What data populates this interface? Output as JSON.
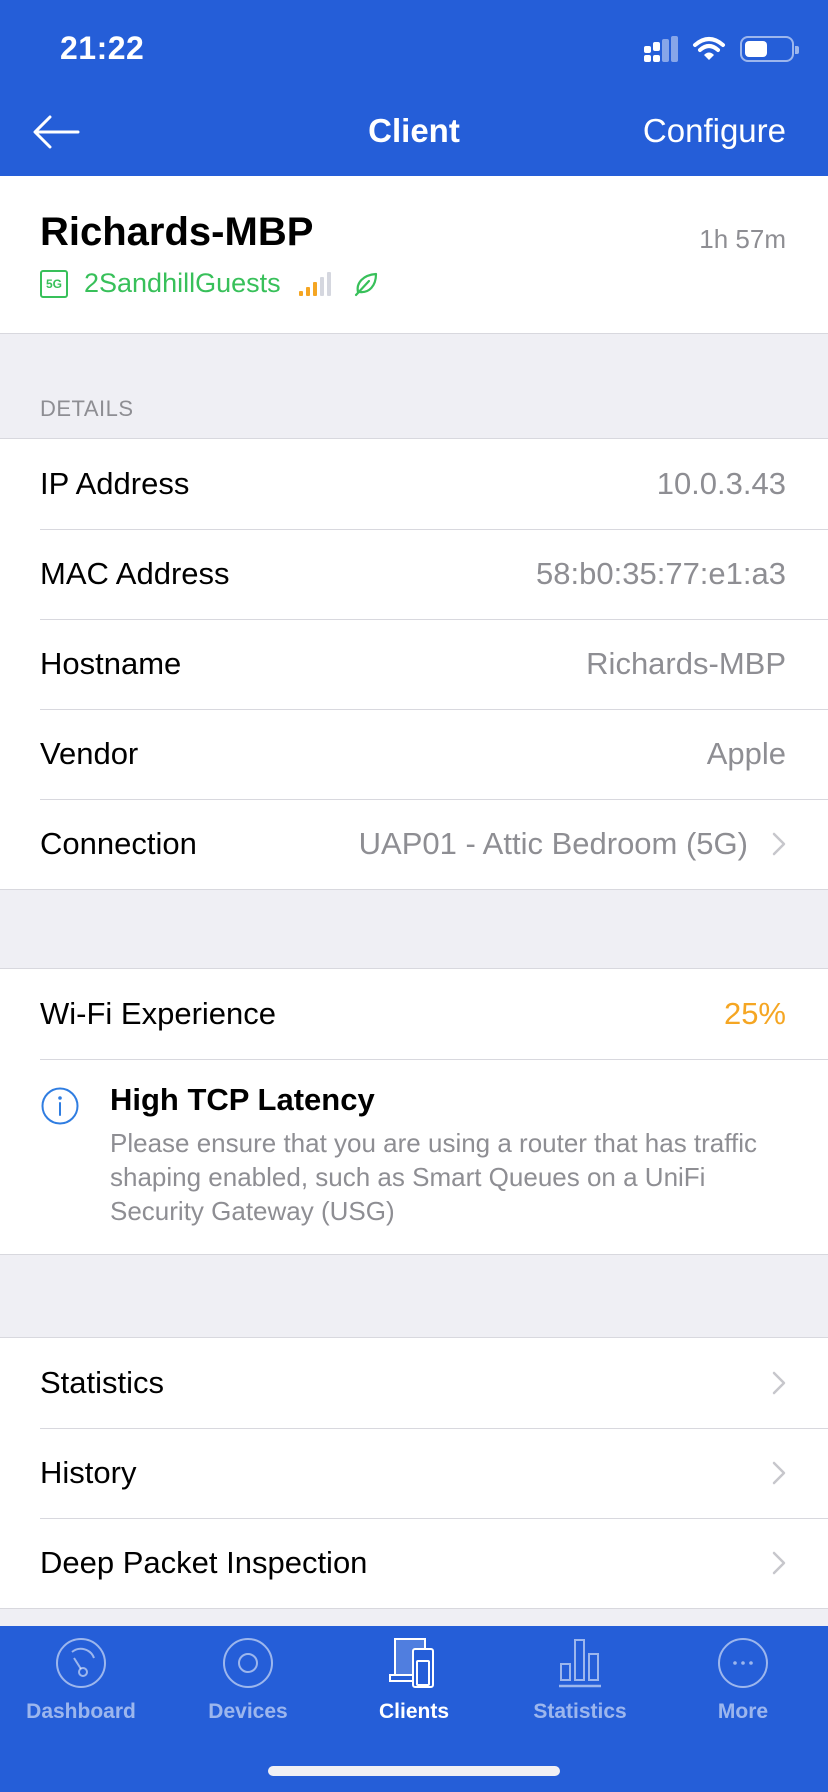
{
  "status_bar": {
    "time": "21:22"
  },
  "nav": {
    "title": "Client",
    "configure_label": "Configure",
    "back_icon": "arrow-left-icon"
  },
  "client": {
    "name": "Richards-MBP",
    "uptime": "1h 57m",
    "band": "5G",
    "ssid": "2SandhillGuests",
    "signal": {
      "active_bars": 3,
      "total_bars": 5,
      "active_color": "#f5a623",
      "inactive_color": "#d5d7df"
    },
    "power_save_icon": "leaf-icon"
  },
  "details": {
    "header": "DETAILS",
    "rows": [
      {
        "label": "IP Address",
        "value": "10.0.3.43"
      },
      {
        "label": "MAC Address",
        "value": "58:b0:35:77:e1:a3"
      },
      {
        "label": "Hostname",
        "value": "Richards-MBP"
      },
      {
        "label": "Vendor",
        "value": "Apple"
      },
      {
        "label": "Connection",
        "value": "UAP01 - Attic Bedroom (5G)",
        "chevron": true
      }
    ]
  },
  "wifi_experience": {
    "label": "Wi-Fi Experience",
    "value": "25%",
    "value_color": "#f5a623",
    "alert": {
      "icon": "info-icon",
      "title": "High TCP Latency",
      "body": "Please ensure that you are using a router that has traffic shaping enabled, such as Smart Queues on a UniFi Security Gateway (USG)"
    }
  },
  "links": [
    {
      "label": "Statistics"
    },
    {
      "label": "History"
    },
    {
      "label": "Deep Packet Inspection"
    }
  ],
  "tabbar": {
    "active": "Clients",
    "tabs": [
      {
        "label": "Dashboard",
        "icon": "gauge-icon"
      },
      {
        "label": "Devices",
        "icon": "access-point-icon"
      },
      {
        "label": "Clients",
        "icon": "devices-icon"
      },
      {
        "label": "Statistics",
        "icon": "bar-chart-icon"
      },
      {
        "label": "More",
        "icon": "more-icon"
      }
    ]
  },
  "colors": {
    "brand_blue": "#255ed8",
    "green": "#38c05a",
    "orange": "#f5a623",
    "info_blue": "#2f7de1"
  }
}
